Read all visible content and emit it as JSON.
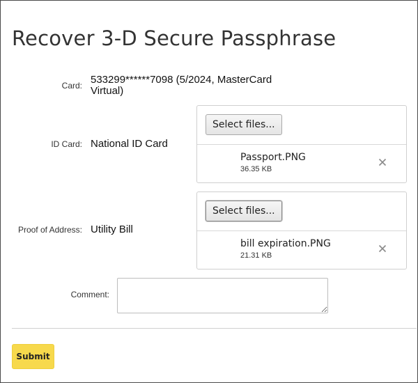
{
  "page": {
    "title": "Recover 3-D Secure Passphrase"
  },
  "form": {
    "card_label": "Card:",
    "card_value": "533299******7098 (5/2024, MasterCard Virtual)",
    "id_card_label": "ID Card:",
    "id_card_value": "National ID Card",
    "proof_label": "Proof of Address:",
    "proof_value": "Utility Bill",
    "comment_label": "Comment:",
    "comment_value": "",
    "submit_label": "Submit"
  },
  "uploads": {
    "id_card": {
      "select_label": "Select files...",
      "file_name": "Passport.PNG",
      "file_size": "36.35 KB",
      "remove_icon": "close-icon"
    },
    "proof": {
      "select_label": "Select files...",
      "file_name": "bill expiration.PNG",
      "file_size": "21.31 KB",
      "remove_icon": "close-icon"
    }
  },
  "colors": {
    "submit_bg": "#f7d94c",
    "title": "#333333",
    "border": "#cfcfcf"
  }
}
